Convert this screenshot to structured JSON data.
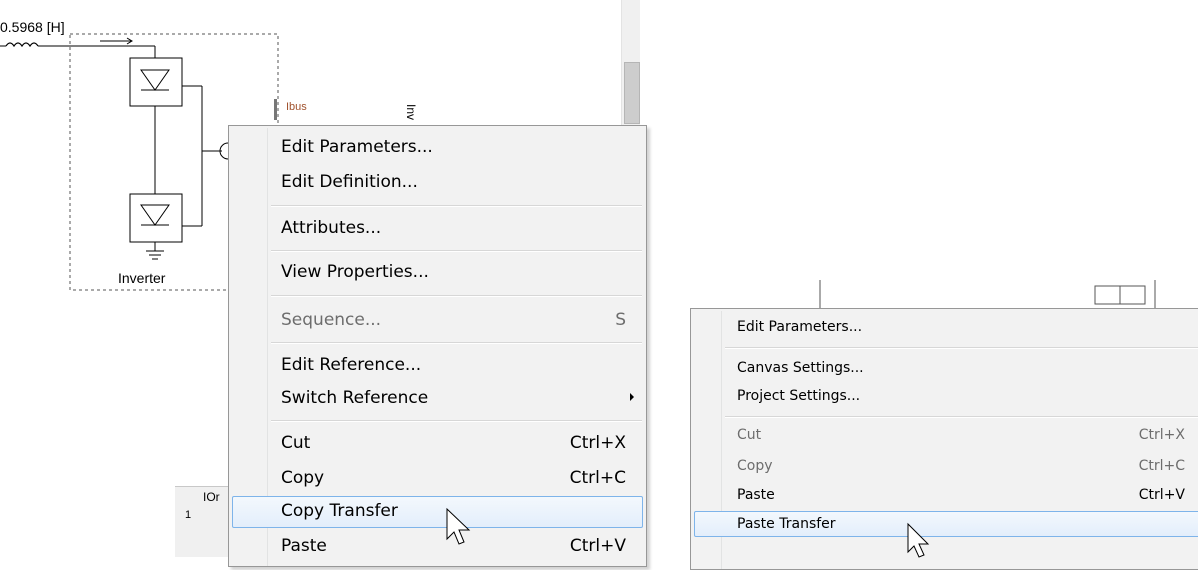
{
  "schematic": {
    "inductance_label": "0.5968 [H]",
    "inverter_label": "Inverter",
    "ibus_label": "Ibus",
    "inv_label": "Inv",
    "table_header": "IOr",
    "table_row": "1"
  },
  "context_menu_component": {
    "items": [
      {
        "label": "Edit Parameters...",
        "shortcut": ""
      },
      {
        "label": "Edit Definition...",
        "shortcut": ""
      },
      {
        "label": "Attributes...",
        "shortcut": ""
      },
      {
        "label": "View Properties...",
        "shortcut": ""
      },
      {
        "label": "Sequence...",
        "shortcut": "S",
        "disabled": true
      },
      {
        "label": "Edit Reference...",
        "shortcut": ""
      },
      {
        "label": "Switch Reference",
        "shortcut": "",
        "submenu": true
      },
      {
        "label": "Cut",
        "shortcut": "Ctrl+X"
      },
      {
        "label": "Copy",
        "shortcut": "Ctrl+C"
      },
      {
        "label": "Copy Transfer",
        "shortcut": "",
        "highlighted": true
      },
      {
        "label": "Paste",
        "shortcut": "Ctrl+V"
      }
    ]
  },
  "context_menu_canvas": {
    "items": [
      {
        "label": "Edit Parameters...",
        "shortcut": ""
      },
      {
        "label": "Canvas Settings...",
        "shortcut": ""
      },
      {
        "label": "Project Settings...",
        "shortcut": ""
      },
      {
        "label": "Cut",
        "shortcut": "Ctrl+X",
        "disabled": true
      },
      {
        "label": "Copy",
        "shortcut": "Ctrl+C",
        "disabled": true
      },
      {
        "label": "Paste",
        "shortcut": "Ctrl+V"
      },
      {
        "label": "Paste Transfer",
        "shortcut": "",
        "highlighted": true
      }
    ]
  },
  "colors": {
    "menu_bg": "#f2f2f2",
    "highlight_border": "#7eb4ea",
    "ibus_color": "#a0522d"
  },
  "icons": [
    "inductor-icon",
    "diode-icon",
    "ground-icon",
    "mouse-cursor-icon",
    "submenu-arrow-icon"
  ]
}
